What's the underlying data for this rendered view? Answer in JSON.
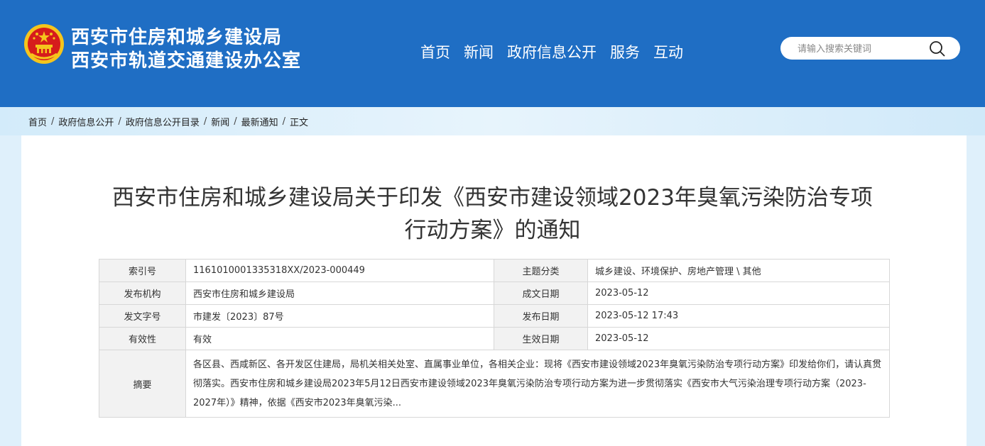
{
  "header": {
    "org_line1": "西安市住房和城乡建设局",
    "org_line2": "西安市轨道交通建设办公室",
    "emblem_icon": "national-emblem-icon",
    "nav": [
      "首页",
      "新闻",
      "政府信息公开",
      "服务",
      "互动"
    ],
    "search_placeholder": "请输入搜索关键词",
    "colors": {
      "header_bg": "#1f6ec4",
      "emblem_red": "#d61c1c",
      "emblem_gold": "#f5c51c"
    }
  },
  "breadcrumb": [
    "首页",
    "政府信息公开",
    "政府信息公开目录",
    "新闻",
    "最新通知",
    "正文"
  ],
  "breadcrumb_separator": "/",
  "article": {
    "title_line1": "西安市住房和城乡建设局关于印发《西安市建设领域2023年臭氧污染防治专项",
    "title_line2": "行动方案》的通知"
  },
  "info_table": {
    "index_label": "索引号",
    "index_value": "1161010001335318XX/2023-000449",
    "topic_label": "主题分类",
    "topic_value": "城乡建设、环境保护、房地产管理 \\ 其他",
    "publisher_label": "发布机构",
    "publisher_value": "西安市住房和城乡建设局",
    "created_label": "成文日期",
    "created_value": "2023-05-12",
    "doc_no_label": "发文字号",
    "doc_no_value": "市建发〔2023〕87号",
    "published_label": "发布日期",
    "published_value": "2023-05-12 17:43",
    "validity_label": "有效性",
    "validity_value": "有效",
    "effective_label": "生效日期",
    "effective_value": "2023-05-12",
    "abstract_label": "摘要",
    "abstract_value": "各区县、西咸新区、各开发区住建局，局机关相关处室、直属事业单位，各相关企业：现将《西安市建设领域2023年臭氧污染防治专项行动方案》印发给你们，请认真贯彻落实。西安市住房和城乡建设局2023年5月12日西安市建设领域2023年臭氧污染防治专项行动方案为进一步贯彻落实《西安市大气污染治理专项行动方案（2023-2027年）》精神，依据《西安市2023年臭氧污染..."
  }
}
